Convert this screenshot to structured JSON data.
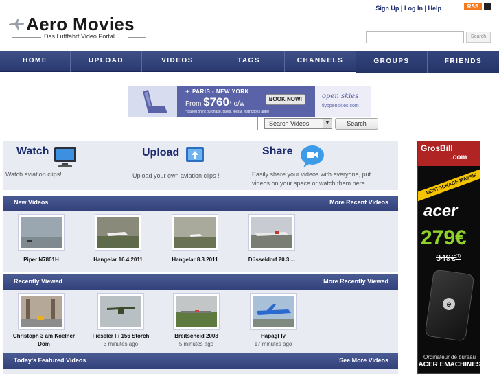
{
  "header": {
    "logo_title": "Aero Movies",
    "tagline": "Das Luftfahrt Video Portal",
    "links": [
      "Sign Up",
      "Log In",
      "Help"
    ],
    "rss_label": "RSS",
    "search_button": "Search"
  },
  "nav": {
    "items": [
      "HOME",
      "UPLOAD",
      "VIDEOS",
      "TAGS",
      "CHANNELS",
      "GROUPS",
      "FRIENDS"
    ]
  },
  "banner_ad": {
    "route": "PARIS - NEW YORK",
    "price_prefix": "From",
    "price": "$760",
    "price_suffix": "* o/w",
    "fine_print": "* based on r/t purchase, taxes, fees & restrictions apply",
    "button": "BOOK NOW!",
    "brand": "open skies",
    "url": "flyopenskies.com"
  },
  "search": {
    "select_value": "Search Videos",
    "button": "Search"
  },
  "features": [
    {
      "title": "Watch",
      "desc": "Watch aviation clips!"
    },
    {
      "title": "Upload",
      "desc": "Upload your own aviation clips !"
    },
    {
      "title": "Share",
      "desc": "Easily share your videos with everyone, put videos on your space or watch them here."
    }
  ],
  "new_videos": {
    "heading": "New Videos",
    "more": "More Recent Videos",
    "items": [
      {
        "title": "Piper N7801H"
      },
      {
        "title": "Hangelar 16.4.2011"
      },
      {
        "title": "Hangelar 8.3.2011"
      },
      {
        "title": "Düsseldorf 20.3...."
      }
    ]
  },
  "recently_viewed": {
    "heading": "Recently Viewed",
    "more": "More Recently Viewed",
    "items": [
      {
        "title": "Christoph 3 am Koelner Dom",
        "time": ""
      },
      {
        "title": "Fieseler Fi 156 Storch",
        "time": "3 minutes ago"
      },
      {
        "title": "Breitscheid 2008",
        "time": "5 minutes ago"
      },
      {
        "title": "HapagFly",
        "time": "17 minutes ago"
      }
    ]
  },
  "featured": {
    "heading": "Today's Featured Videos",
    "more": "See More Videos"
  },
  "side_ad": {
    "brand": "GrosBill",
    "brand_suffix": ".com",
    "ribbon": "DESTOCKAGE MASSIF",
    "product_brand": "acer",
    "price": "279€",
    "old_price": "349€",
    "old_price_note": "(1)",
    "line1": "Ordinateur de bureau",
    "line2": "ACER EMACHINES"
  },
  "colors": {
    "nav": "#2f3f77",
    "section_bar": "#3d4c86",
    "panel_bg": "#e9ebf3",
    "rss": "#f47a20"
  }
}
